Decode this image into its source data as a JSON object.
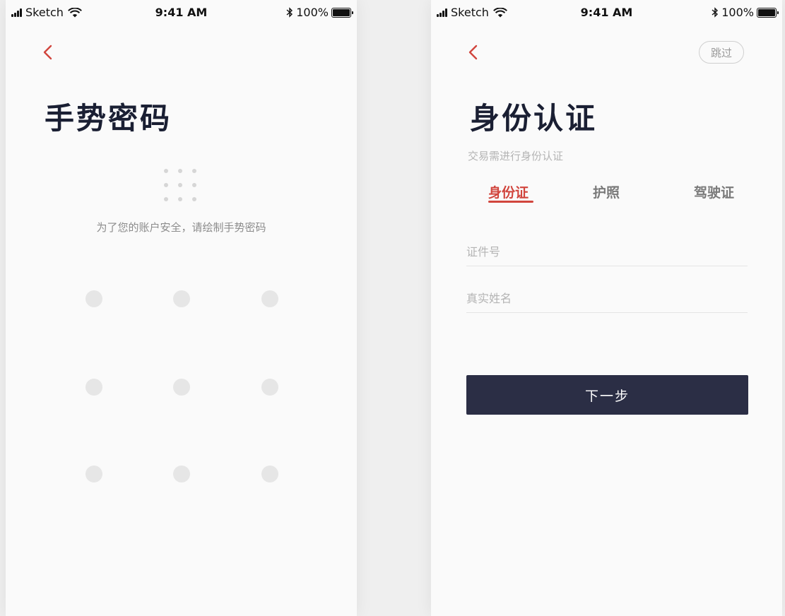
{
  "status_bar": {
    "carrier": "Sketch",
    "time": "9:41 AM",
    "battery": "100%"
  },
  "gesture_screen": {
    "title": "手势密码",
    "hint": "为了您的账户安全，请绘制手势密码",
    "grid_size": 3
  },
  "identity_screen": {
    "skip_label": "跳过",
    "title": "身份认证",
    "subtitle": "交易需进行身份认证",
    "tabs": [
      {
        "label": "身份证",
        "active": true
      },
      {
        "label": "护照",
        "active": false
      },
      {
        "label": "驾驶证",
        "active": false
      }
    ],
    "id_number_placeholder": "证件号",
    "real_name_placeholder": "真实姓名",
    "next_label": "下一步"
  },
  "colors": {
    "accent": "#d1453d",
    "title": "#1a1f33",
    "button": "#2b2e45",
    "dot": "#e6e6e6"
  }
}
